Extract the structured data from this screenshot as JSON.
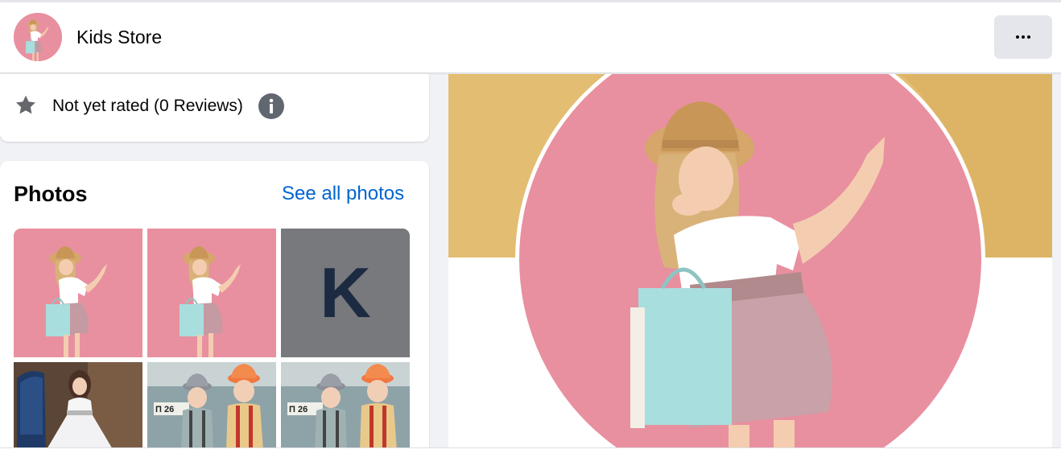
{
  "header": {
    "page_name": "Kids Store",
    "more_button_icon": "more-horizontal-icon"
  },
  "rating": {
    "text": "Not yet rated (0 Reviews)",
    "star_icon": "star-icon",
    "info_icon": "info-icon"
  },
  "photos": {
    "title": "Photos",
    "see_all_label": "See all photos",
    "k_tile_letter": "K"
  },
  "colors": {
    "link": "#0064d1",
    "background": "#f0f2f5",
    "button_grey": "#e4e6eb",
    "k_tile_bg": "#77797d",
    "k_letter": "#1c2b41",
    "pink_photo_bg": "#e8909f",
    "cover_mustard": "#e3bd71"
  }
}
